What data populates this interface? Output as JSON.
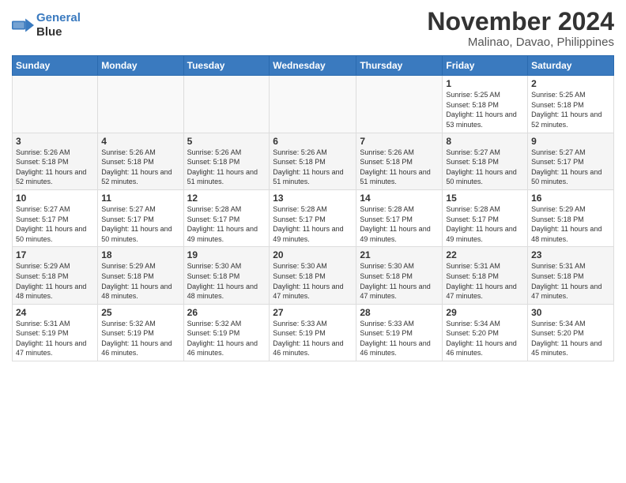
{
  "logo": {
    "line1": "General",
    "line2": "Blue"
  },
  "title": "November 2024",
  "location": "Malinao, Davao, Philippines",
  "weekdays": [
    "Sunday",
    "Monday",
    "Tuesday",
    "Wednesday",
    "Thursday",
    "Friday",
    "Saturday"
  ],
  "weeks": [
    [
      {
        "day": "",
        "info": ""
      },
      {
        "day": "",
        "info": ""
      },
      {
        "day": "",
        "info": ""
      },
      {
        "day": "",
        "info": ""
      },
      {
        "day": "",
        "info": ""
      },
      {
        "day": "1",
        "info": "Sunrise: 5:25 AM\nSunset: 5:18 PM\nDaylight: 11 hours and 53 minutes."
      },
      {
        "day": "2",
        "info": "Sunrise: 5:25 AM\nSunset: 5:18 PM\nDaylight: 11 hours and 52 minutes."
      }
    ],
    [
      {
        "day": "3",
        "info": "Sunrise: 5:26 AM\nSunset: 5:18 PM\nDaylight: 11 hours and 52 minutes."
      },
      {
        "day": "4",
        "info": "Sunrise: 5:26 AM\nSunset: 5:18 PM\nDaylight: 11 hours and 52 minutes."
      },
      {
        "day": "5",
        "info": "Sunrise: 5:26 AM\nSunset: 5:18 PM\nDaylight: 11 hours and 51 minutes."
      },
      {
        "day": "6",
        "info": "Sunrise: 5:26 AM\nSunset: 5:18 PM\nDaylight: 11 hours and 51 minutes."
      },
      {
        "day": "7",
        "info": "Sunrise: 5:26 AM\nSunset: 5:18 PM\nDaylight: 11 hours and 51 minutes."
      },
      {
        "day": "8",
        "info": "Sunrise: 5:27 AM\nSunset: 5:18 PM\nDaylight: 11 hours and 50 minutes."
      },
      {
        "day": "9",
        "info": "Sunrise: 5:27 AM\nSunset: 5:17 PM\nDaylight: 11 hours and 50 minutes."
      }
    ],
    [
      {
        "day": "10",
        "info": "Sunrise: 5:27 AM\nSunset: 5:17 PM\nDaylight: 11 hours and 50 minutes."
      },
      {
        "day": "11",
        "info": "Sunrise: 5:27 AM\nSunset: 5:17 PM\nDaylight: 11 hours and 50 minutes."
      },
      {
        "day": "12",
        "info": "Sunrise: 5:28 AM\nSunset: 5:17 PM\nDaylight: 11 hours and 49 minutes."
      },
      {
        "day": "13",
        "info": "Sunrise: 5:28 AM\nSunset: 5:17 PM\nDaylight: 11 hours and 49 minutes."
      },
      {
        "day": "14",
        "info": "Sunrise: 5:28 AM\nSunset: 5:17 PM\nDaylight: 11 hours and 49 minutes."
      },
      {
        "day": "15",
        "info": "Sunrise: 5:28 AM\nSunset: 5:17 PM\nDaylight: 11 hours and 49 minutes."
      },
      {
        "day": "16",
        "info": "Sunrise: 5:29 AM\nSunset: 5:18 PM\nDaylight: 11 hours and 48 minutes."
      }
    ],
    [
      {
        "day": "17",
        "info": "Sunrise: 5:29 AM\nSunset: 5:18 PM\nDaylight: 11 hours and 48 minutes."
      },
      {
        "day": "18",
        "info": "Sunrise: 5:29 AM\nSunset: 5:18 PM\nDaylight: 11 hours and 48 minutes."
      },
      {
        "day": "19",
        "info": "Sunrise: 5:30 AM\nSunset: 5:18 PM\nDaylight: 11 hours and 48 minutes."
      },
      {
        "day": "20",
        "info": "Sunrise: 5:30 AM\nSunset: 5:18 PM\nDaylight: 11 hours and 47 minutes."
      },
      {
        "day": "21",
        "info": "Sunrise: 5:30 AM\nSunset: 5:18 PM\nDaylight: 11 hours and 47 minutes."
      },
      {
        "day": "22",
        "info": "Sunrise: 5:31 AM\nSunset: 5:18 PM\nDaylight: 11 hours and 47 minutes."
      },
      {
        "day": "23",
        "info": "Sunrise: 5:31 AM\nSunset: 5:18 PM\nDaylight: 11 hours and 47 minutes."
      }
    ],
    [
      {
        "day": "24",
        "info": "Sunrise: 5:31 AM\nSunset: 5:19 PM\nDaylight: 11 hours and 47 minutes."
      },
      {
        "day": "25",
        "info": "Sunrise: 5:32 AM\nSunset: 5:19 PM\nDaylight: 11 hours and 46 minutes."
      },
      {
        "day": "26",
        "info": "Sunrise: 5:32 AM\nSunset: 5:19 PM\nDaylight: 11 hours and 46 minutes."
      },
      {
        "day": "27",
        "info": "Sunrise: 5:33 AM\nSunset: 5:19 PM\nDaylight: 11 hours and 46 minutes."
      },
      {
        "day": "28",
        "info": "Sunrise: 5:33 AM\nSunset: 5:19 PM\nDaylight: 11 hours and 46 minutes."
      },
      {
        "day": "29",
        "info": "Sunrise: 5:34 AM\nSunset: 5:20 PM\nDaylight: 11 hours and 46 minutes."
      },
      {
        "day": "30",
        "info": "Sunrise: 5:34 AM\nSunset: 5:20 PM\nDaylight: 11 hours and 45 minutes."
      }
    ]
  ]
}
